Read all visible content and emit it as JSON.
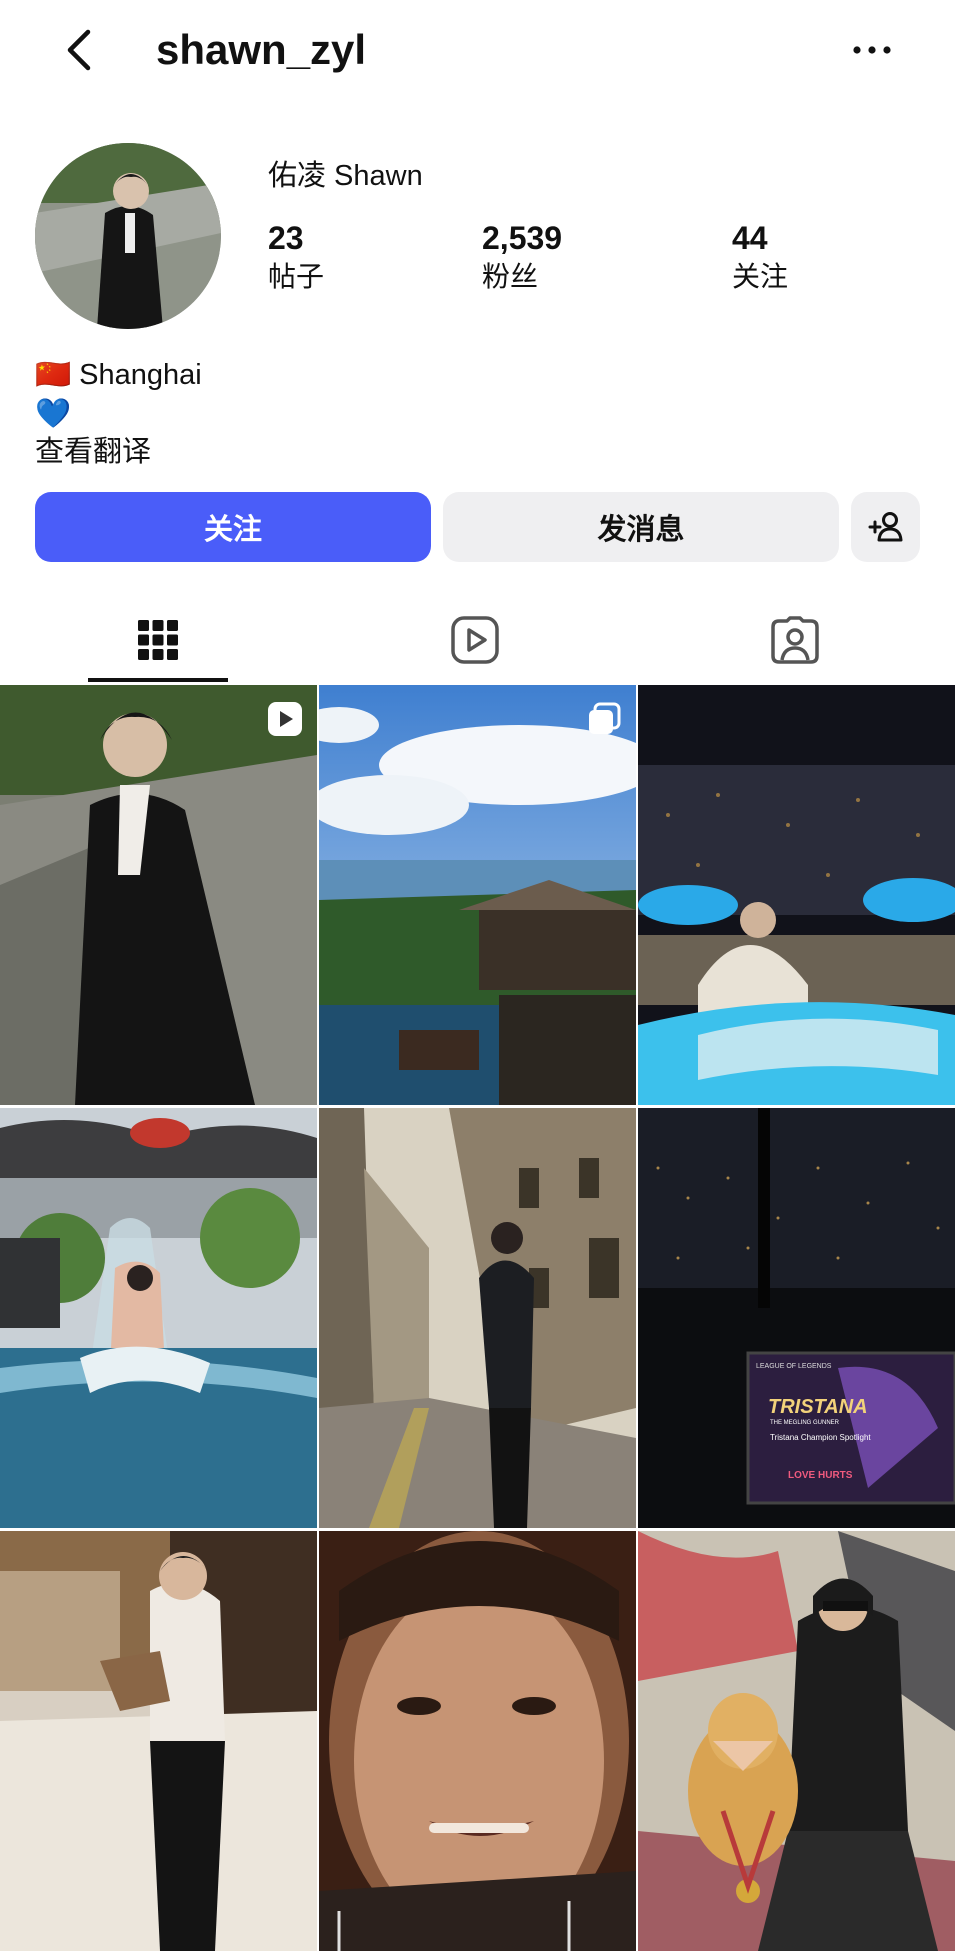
{
  "header": {
    "username": "shawn_zyl",
    "back_icon": "chevron-left-icon",
    "more_icon": "more-horizontal-icon"
  },
  "profile": {
    "display_name": "佑凌 Shawn",
    "stats": [
      {
        "value": "23",
        "label": "帖子"
      },
      {
        "value": "2,539",
        "label": "粉丝"
      },
      {
        "value": "44",
        "label": "关注"
      }
    ],
    "bio": {
      "flag": "🇨🇳",
      "location": "Shanghai",
      "heart": "💙",
      "translate_link": "查看翻译"
    }
  },
  "actions": {
    "follow_label": "关注",
    "message_label": "发消息",
    "suggest_icon": "add-person-icon"
  },
  "tabs": [
    {
      "icon": "grid-icon",
      "active": true
    },
    {
      "icon": "reels-icon",
      "active": false
    },
    {
      "icon": "tagged-icon",
      "active": false
    }
  ],
  "colors": {
    "accent": "#4a5df9",
    "secondary_button": "#efeff1"
  },
  "posts": [
    {
      "badge": "reel-badge-icon"
    },
    {
      "badge": "carousel-badge-icon"
    },
    {
      "badge": null
    },
    {
      "badge": null
    },
    {
      "badge": null
    },
    {
      "badge": null,
      "text": [
        "LEAGUE OF LEGENDS",
        "TRISTANA",
        "THE MEGLING GUNNER",
        "Tristana Champion Spotlight",
        "LOVE HURTS"
      ]
    },
    {
      "badge": null
    },
    {
      "badge": null
    },
    {
      "badge": null
    }
  ]
}
